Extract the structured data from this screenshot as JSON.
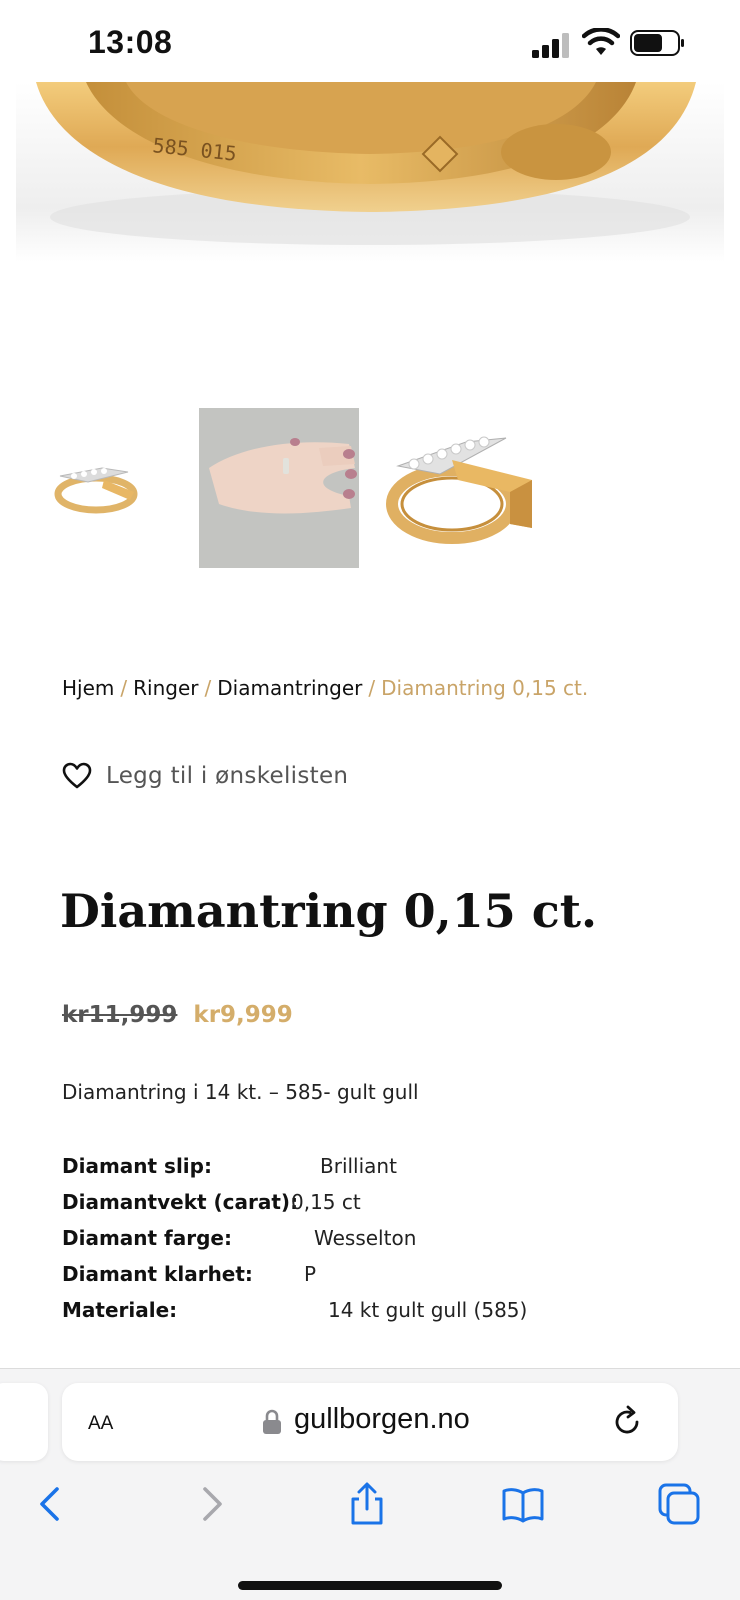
{
  "status_bar": {
    "time": "13:08"
  },
  "breadcrumb": {
    "items": [
      "Hjem",
      "Ringer",
      "Diamantringer"
    ],
    "current": "Diamantring 0,15 ct.",
    "separator": "/"
  },
  "wishlist": {
    "label": "Legg til i ønskelisten"
  },
  "product": {
    "title": "Diamantring 0,15 ct.",
    "price_old": "kr11,999",
    "price_new": "kr9,999",
    "description": "Diamantring i 14 kt. – 585- gult gull",
    "specs": [
      {
        "key": "Diamant slip:",
        "value": "Brilliant"
      },
      {
        "key": "Diamantvekt (carat):",
        "value": "0,15 ct"
      },
      {
        "key": "Diamant farge:",
        "value": "Wesselton"
      },
      {
        "key": "Diamant klarhet:",
        "value": "P"
      },
      {
        "key": "Materiale:",
        "value": "14 kt gult gull (585)"
      }
    ]
  },
  "hero": {
    "engraving": "585 015"
  },
  "browser": {
    "text_size_label": "AA",
    "url": "gullborgen.no"
  },
  "colors": {
    "accent_gold": "#c9a468",
    "price_gold": "#d4ad6a",
    "ios_blue": "#1a73e8"
  }
}
